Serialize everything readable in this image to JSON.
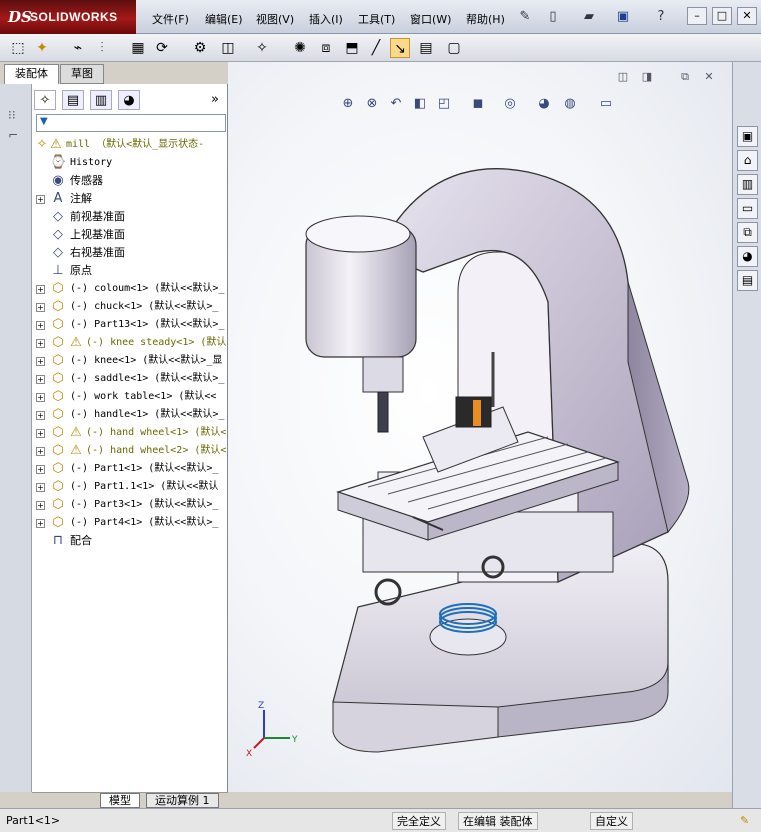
{
  "app": {
    "logo_ds": "DS",
    "logo_name": "SOLIDWORKS"
  },
  "menu": {
    "items": [
      "文件(F)",
      "编辑(E)",
      "视图(V)",
      "插入(I)",
      "工具(T)",
      "窗口(W)",
      "帮助(H)"
    ]
  },
  "panel_tabs": [
    "装配体",
    "草图"
  ],
  "tree": {
    "root": "mill （默认<默认_显示状态-",
    "items": [
      {
        "label": "History",
        "cn": false,
        "icon": "history-icon",
        "expand": false,
        "warn": false
      },
      {
        "label": "传感器",
        "cn": true,
        "icon": "sensor-icon",
        "expand": false,
        "warn": false
      },
      {
        "label": "注解",
        "cn": true,
        "icon": "annotation-icon",
        "expand": true,
        "warn": false
      },
      {
        "label": "前视基准面",
        "cn": true,
        "icon": "plane-icon",
        "expand": false,
        "warn": false
      },
      {
        "label": "上视基准面",
        "cn": true,
        "icon": "plane-icon",
        "expand": false,
        "warn": false
      },
      {
        "label": "右视基准面",
        "cn": true,
        "icon": "plane-icon",
        "expand": false,
        "warn": false
      },
      {
        "label": "原点",
        "cn": true,
        "icon": "origin-icon",
        "expand": false,
        "warn": false
      },
      {
        "label": "(-) coloum<1> (默认<<默认>_",
        "cn": false,
        "icon": "part-icon",
        "expand": true,
        "warn": false
      },
      {
        "label": "(-) chuck<1> (默认<<默认>_",
        "cn": false,
        "icon": "part-icon",
        "expand": true,
        "warn": false
      },
      {
        "label": "(-) Part13<1> (默认<<默认>_",
        "cn": false,
        "icon": "part-icon",
        "expand": true,
        "warn": false
      },
      {
        "label": "(-) knee steady<1> (默认",
        "cn": false,
        "icon": "part-icon",
        "expand": true,
        "warn": true
      },
      {
        "label": "(-) knee<1> (默认<<默认>_显",
        "cn": false,
        "icon": "part-icon",
        "expand": true,
        "warn": false
      },
      {
        "label": "(-) saddle<1> (默认<<默认>_",
        "cn": false,
        "icon": "part-icon",
        "expand": true,
        "warn": false
      },
      {
        "label": "(-) work table<1> (默认<<",
        "cn": false,
        "icon": "part-icon",
        "expand": true,
        "warn": false
      },
      {
        "label": "(-) handle<1> (默认<<默认>_",
        "cn": false,
        "icon": "part-icon",
        "expand": true,
        "warn": false
      },
      {
        "label": "(-) hand wheel<1> (默认<",
        "cn": false,
        "icon": "part-icon",
        "expand": true,
        "warn": true
      },
      {
        "label": "(-) hand wheel<2> (默认<",
        "cn": false,
        "icon": "part-icon",
        "expand": true,
        "warn": true
      },
      {
        "label": "(-) Part1<1> (默认<<默认>_",
        "cn": false,
        "icon": "part-icon",
        "expand": true,
        "warn": false
      },
      {
        "label": "(-) Part1.1<1> (默认<<默认",
        "cn": false,
        "icon": "part-icon",
        "expand": true,
        "warn": false
      },
      {
        "label": "(-) Part3<1> (默认<<默认>_",
        "cn": false,
        "icon": "part-icon",
        "expand": true,
        "warn": false
      },
      {
        "label": "(-) Part4<1> (默认<<默认>_",
        "cn": false,
        "icon": "part-icon",
        "expand": true,
        "warn": false
      },
      {
        "label": "配合",
        "cn": true,
        "icon": "mates-icon",
        "expand": false,
        "warn": false
      }
    ]
  },
  "bottom_tabs": [
    "模型",
    "运动算例 1"
  ],
  "status": {
    "part": "Part1<1>",
    "def": "完全定义",
    "editing": "在编辑 装配体",
    "custom": "自定义"
  },
  "axes": {
    "x": "X",
    "y": "Y",
    "z": "Z"
  },
  "colors": {
    "model": "#d5d2dc",
    "model_dark": "#a59fb3",
    "accent": "#e98d22"
  }
}
